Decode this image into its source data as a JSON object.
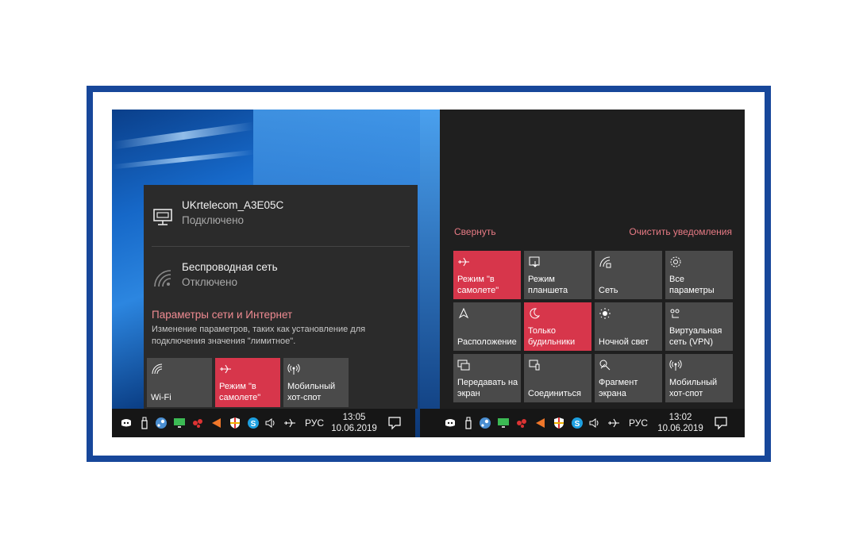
{
  "left_panel": {
    "networks": [
      {
        "name": "UKrtelecom_A3E05C",
        "status": "Подключено",
        "icon": "ethernet-icon"
      },
      {
        "name": "Беспроводная сеть",
        "status": "Отключено",
        "icon": "wifi-icon"
      }
    ],
    "settings_link": "Параметры сети и Интернет",
    "settings_desc": "Изменение параметров, таких как установление для подключения значения \"лимитное\".",
    "tiles": [
      {
        "label": "Wi-Fi",
        "icon": "wifi-icon",
        "active": false
      },
      {
        "label": "Режим \"в\nсамолете\"",
        "icon": "airplane-icon",
        "active": true
      },
      {
        "label": "Мобильный\nхот-спот",
        "icon": "hotspot-icon",
        "active": false
      }
    ],
    "taskbar": {
      "lang": "РУС",
      "time": "13:05",
      "date": "10.06.2019"
    }
  },
  "right_panel": {
    "collapse_label": "Свернуть",
    "clear_label": "Очистить уведомления",
    "tiles": [
      {
        "label": "Режим \"в\nсамолете\"",
        "icon": "airplane-icon",
        "active": true
      },
      {
        "label": "Режим\nпланшета",
        "icon": "tablet-mode-icon",
        "active": false
      },
      {
        "label": "Сеть",
        "icon": "network-icon",
        "active": false
      },
      {
        "label": "Все\nпараметры",
        "icon": "gear-icon",
        "active": false
      },
      {
        "label": "Расположение",
        "icon": "location-icon",
        "active": false
      },
      {
        "label": "Только\nбудильники",
        "icon": "moon-icon",
        "active": true
      },
      {
        "label": "Ночной свет",
        "icon": "sun-icon",
        "active": false
      },
      {
        "label": "Виртуальная\nсеть (VPN)",
        "icon": "vpn-icon",
        "active": false
      },
      {
        "label": "Передавать на\nэкран",
        "icon": "project-icon",
        "active": false
      },
      {
        "label": "Соединиться",
        "icon": "connect-icon",
        "active": false
      },
      {
        "label": "Фрагмент\nэкрана",
        "icon": "snip-icon",
        "active": false
      },
      {
        "label": "Мобильный\nхот-спот",
        "icon": "hotspot-icon",
        "active": false
      }
    ],
    "taskbar": {
      "lang": "РУС",
      "time": "13:02",
      "date": "10.06.2019"
    }
  },
  "colors": {
    "frame": "#17479a",
    "accent_red": "#d7364b",
    "link_pink": "#e87b85",
    "tile_grey": "#4a4a4a"
  }
}
